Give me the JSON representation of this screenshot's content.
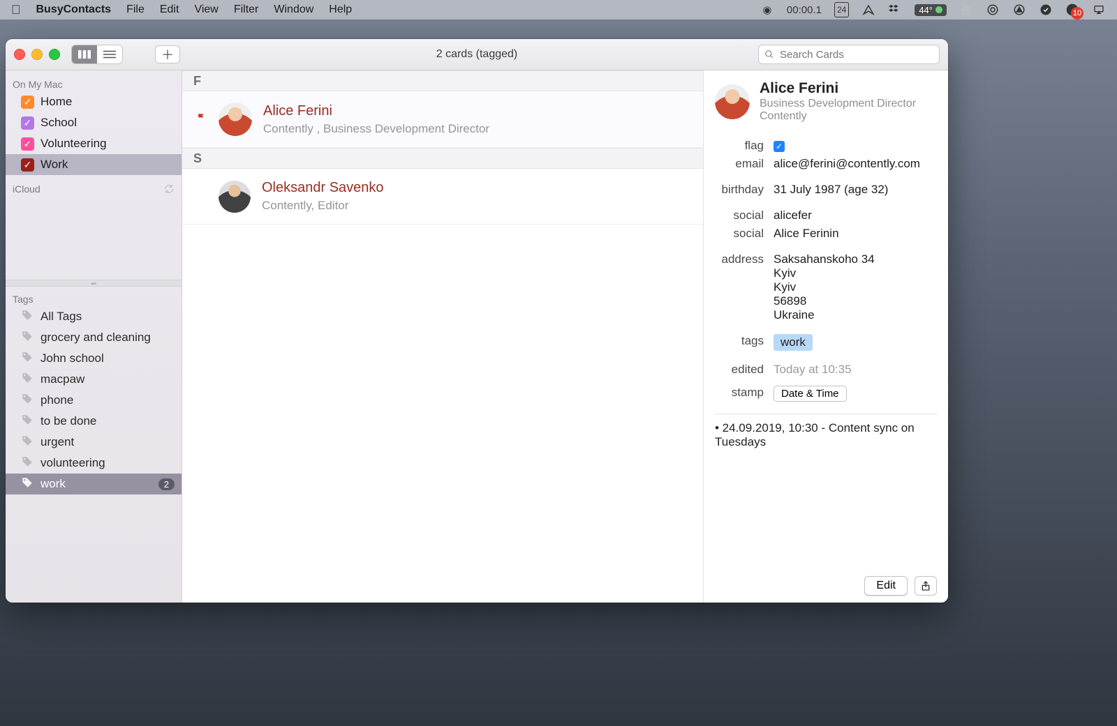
{
  "menubar": {
    "app_name": "BusyContacts",
    "items": [
      "File",
      "Edit",
      "View",
      "Filter",
      "Window",
      "Help"
    ],
    "timer": "00:00.1",
    "date_box": "24",
    "temp_pill": "44°",
    "notif_badge": "10"
  },
  "toolbar": {
    "window_title": "2 cards (tagged)",
    "search_placeholder": "Search Cards"
  },
  "sidebar": {
    "section1_title": "On My Mac",
    "groups": [
      {
        "label": "Home",
        "color": "orange"
      },
      {
        "label": "School",
        "color": "purple"
      },
      {
        "label": "Volunteering",
        "color": "pink"
      },
      {
        "label": "Work",
        "color": "darkred",
        "selected": true
      }
    ],
    "section2_title": "iCloud",
    "section3_title": "Tags",
    "tags": [
      {
        "label": "All Tags"
      },
      {
        "label": "grocery and cleaning"
      },
      {
        "label": "John school"
      },
      {
        "label": "macpaw"
      },
      {
        "label": "phone"
      },
      {
        "label": "to be done"
      },
      {
        "label": "urgent"
      },
      {
        "label": "volunteering"
      },
      {
        "label": "work",
        "count": "2",
        "selected": true
      }
    ]
  },
  "cards": {
    "sections": [
      {
        "letter": "F",
        "rows": [
          {
            "name": "Alice Ferini",
            "subtitle": "Contently , Business Development Director",
            "flagged": true,
            "avatar": "f1",
            "selected": true
          }
        ]
      },
      {
        "letter": "S",
        "rows": [
          {
            "name": "Oleksandr Savenko",
            "subtitle": "Contently, Editor",
            "flagged": false,
            "avatar": "f2"
          }
        ]
      }
    ]
  },
  "detail": {
    "name": "Alice Ferini",
    "job": "Business Development Director",
    "company": "Contently",
    "labels": {
      "flag": "flag",
      "email": "email",
      "birthday": "birthday",
      "social1": "social",
      "social2": "social",
      "address": "address",
      "tags": "tags",
      "edited": "edited",
      "stamp": "stamp"
    },
    "values": {
      "email": "alice@ferini@contently.com",
      "birthday": "31 July 1987 (age 32)",
      "social1": "alicefer",
      "social2": "Alice Ferinin",
      "address_lines": [
        "Saksahanskoho 34",
        "Kyiv",
        "Kyiv",
        "56898",
        "Ukraine"
      ],
      "tag": "work",
      "edited": "Today at 10:35",
      "stamp_btn": "Date & Time"
    },
    "note": "• 24.09.2019, 10:30 - Content sync on Tuesdays",
    "edit_btn": "Edit"
  }
}
